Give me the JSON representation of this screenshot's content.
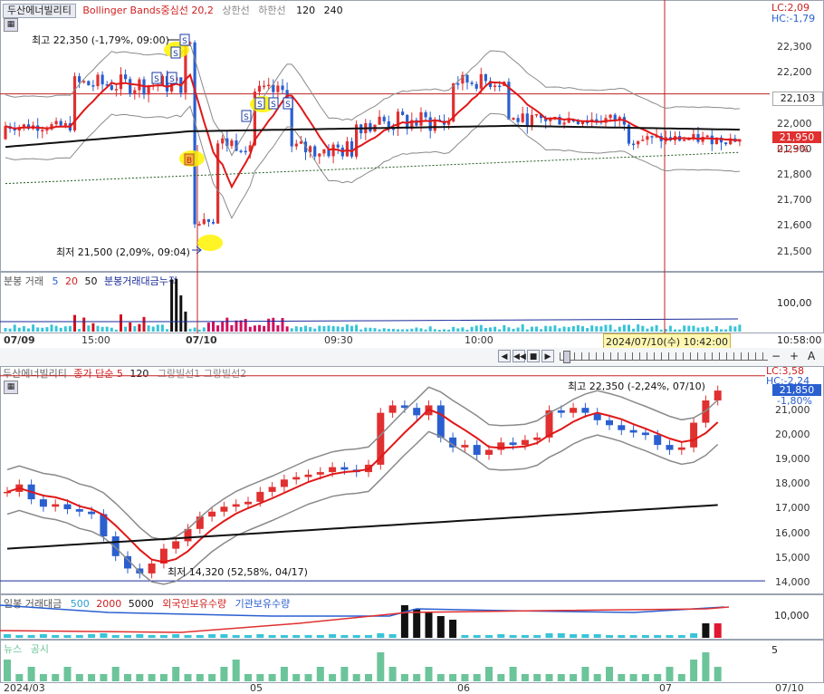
{
  "top": {
    "title": "두산에너빌리티",
    "indicator": "Bollinger Bands중심선 20,2",
    "band_upper": "상한선",
    "band_lower": "하한선",
    "ma1": "120",
    "ma2": "240",
    "lc": "LC:2,09",
    "hc": "HC:-1,79",
    "high_note": "최고 22,350 (-1,79%, 09:00)",
    "low_note": "최저 21,500 (2,09%, 09:04)",
    "y_ticks": [
      "22,300",
      "22,200",
      "22,100",
      "22,000",
      "21,900",
      "21,800",
      "21,700",
      "21,600",
      "21,500"
    ],
    "price_tag": "22,103",
    "cur_price": "21,950",
    "cur_pct": "0,23%",
    "vol_label": "분봉 거래",
    "vol_ma1": "5",
    "vol_ma2": "20",
    "vol_ma3": "50",
    "vol_cum": "분봉거래대금누적",
    "vol_y": "100,00",
    "x_labels": [
      "07/09",
      "15:00",
      "07/10",
      "09:30",
      "10:00"
    ],
    "cursor_time": "2024/07/10(수) 10:42:00",
    "right_time": "10:58:00",
    "ctrl_minus": "−",
    "ctrl_plus": "+",
    "ctrl_A": "A",
    "buy_marker": "S",
    "sell_marker": "B"
  },
  "bottom": {
    "title": "두산에너빌리티",
    "indicator_short": "종가 단순 5",
    "indicator_120": "120",
    "band_text": "그랑빌선1 그랑빌선2",
    "lc": "LC:3,58",
    "hc": "HC:-2,24",
    "high_note": "최고 22,350 (-2,24%, 07/10)",
    "low_note": "최저 14,320 (52,58%, 04/17)",
    "y_ticks": [
      "21,000",
      "20,000",
      "19,000",
      "18,000",
      "17,000",
      "16,000",
      "15,000",
      "14,000"
    ],
    "cur_price": "21,850",
    "cur_pct": "-1,80%",
    "vol_label": "일봉 거래대금",
    "vol_ma1": "500",
    "vol_ma2": "2000",
    "vol_ma3": "5000",
    "foreign": "외국인보유수량",
    "inst": "기관보유수량",
    "vol_y": "10,000",
    "news_label": "뉴스",
    "disc_label": "공시",
    "news_y": "5",
    "x_labels": [
      "2024/03",
      "05",
      "06",
      "07"
    ],
    "right_date": "07/10"
  },
  "colors": {
    "up": "#e03030",
    "down": "#2a5fd0",
    "ma_red": "#e01818",
    "ma_black": "#111111",
    "band": "#8a8a8a",
    "highlight": "#fff200",
    "cursor": "#c02020",
    "news": "#6cc49a"
  },
  "chart_data": [
    {
      "type": "candlestick",
      "title": "",
      "ylim": [
        21450,
        22400
      ],
      "price_now": 21950,
      "max": 22350,
      "min": 21500
    },
    {
      "type": "candlestick",
      "title": "",
      "ylim": [
        13800,
        22600
      ],
      "price_now": 21850,
      "max": 22350,
      "min": 14320
    }
  ]
}
